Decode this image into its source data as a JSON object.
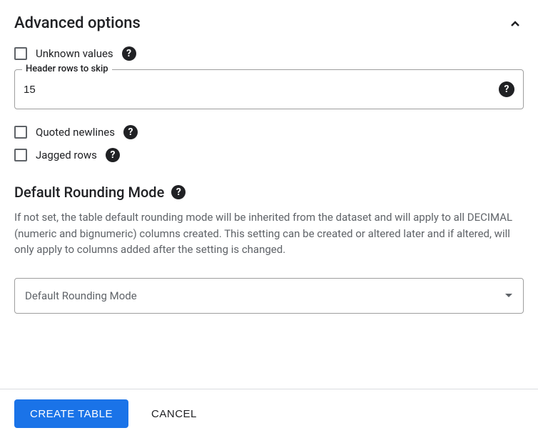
{
  "section": {
    "title": "Advanced options"
  },
  "options": {
    "unknown_values": {
      "label": "Unknown values"
    },
    "header_rows": {
      "label": "Header rows to skip",
      "value": "15"
    },
    "quoted_newlines": {
      "label": "Quoted newlines"
    },
    "jagged_rows": {
      "label": "Jagged rows"
    }
  },
  "rounding": {
    "title": "Default Rounding Mode",
    "description": "If not set, the table default rounding mode will be inherited from the dataset and will apply to all DECIMAL (numeric and bignumeric) columns created. This setting can be created or altered later and if altered, will only apply to columns added after the setting is changed.",
    "selected": "Default Rounding Mode"
  },
  "footer": {
    "create": "CREATE TABLE",
    "cancel": "CANCEL"
  }
}
